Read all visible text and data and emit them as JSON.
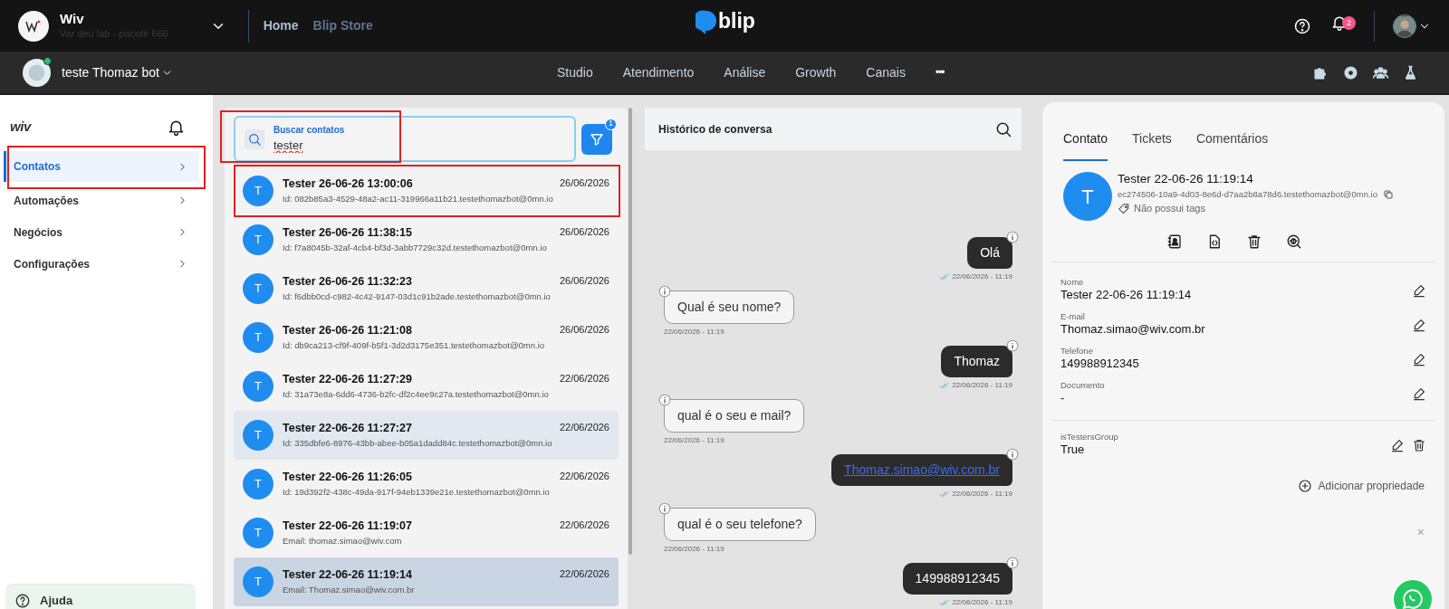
{
  "topbar": {
    "org_name": "Wiv",
    "org_subtitle": "Var deu lab - pacote 666",
    "tabs": [
      {
        "label": "Home",
        "selected": true
      },
      {
        "label": "Blip Store",
        "selected": false
      }
    ],
    "logo": "blip",
    "notification_count": "2"
  },
  "botbar": {
    "bot_name": "teste Thomaz bot",
    "online": true,
    "nav": [
      "Studio",
      "Atendimento",
      "Análise",
      "Growth",
      "Canais"
    ],
    "more": "•••"
  },
  "sidebar": {
    "logo": "wiv",
    "items": [
      {
        "label": "Contatos",
        "selected": true
      },
      {
        "label": "Automações",
        "selected": false
      },
      {
        "label": "Negócios",
        "selected": false
      },
      {
        "label": "Configurações",
        "selected": false
      }
    ],
    "help": "Ajuda"
  },
  "contacts": {
    "search": {
      "label": "Buscar contatos",
      "value": "tester"
    },
    "filter_count": "1",
    "rows": [
      {
        "initial": "T",
        "name": "Tester 26-06-26 13:00:06",
        "detail": "Id: 082b85a3-4529-48a2-ac11-319966a11b21.testethomazbot@0mn.io",
        "date": "26/06/2026",
        "selected": false,
        "hovered": false,
        "highlighted": true
      },
      {
        "initial": "T",
        "name": "Tester 26-06-26 11:38:15",
        "detail": "Id: f7a8045b-32af-4cb4-bf3d-3abb7729c32d.testethomazbot@0mn.io",
        "date": "26/06/2026",
        "selected": false,
        "hovered": false,
        "highlighted": false
      },
      {
        "initial": "T",
        "name": "Tester 26-06-26 11:32:23",
        "detail": "Id: f6dbb0cd-c982-4c42-9147-03d1c91b2ade.testethomazbot@0mn.io",
        "date": "26/06/2026",
        "selected": false,
        "hovered": false,
        "highlighted": false
      },
      {
        "initial": "T",
        "name": "Tester 26-06-26 11:21:08",
        "detail": "Id: db9ca213-cf9f-409f-b5f1-3d2d3175e351.testethomazbot@0mn.io",
        "date": "26/06/2026",
        "selected": false,
        "hovered": false,
        "highlighted": false
      },
      {
        "initial": "T",
        "name": "Tester 22-06-26 11:27:29",
        "detail": "Id: 31a73e8a-6dd6-4736-b2fc-df2c4ee9c27a.testethomazbot@0mn.io",
        "date": "22/06/2026",
        "selected": false,
        "hovered": false,
        "highlighted": false
      },
      {
        "initial": "T",
        "name": "Tester 22-06-26 11:27:27",
        "detail": "Id: 335dbfe6-8976-43bb-abee-b05a1dadd84c.testethomazbot@0mn.io",
        "date": "22/06/2026",
        "selected": false,
        "hovered": true,
        "highlighted": false
      },
      {
        "initial": "T",
        "name": "Tester 22-06-26 11:26:05",
        "detail": "Id: 19d392f2-438c-49da-917f-94eb1339e21e.testethomazbot@0mn.io",
        "date": "22/06/2026",
        "selected": false,
        "hovered": false,
        "highlighted": false
      },
      {
        "initial": "T",
        "name": "Tester 22-06-26 11:19:07",
        "detail": "Email: thomaz.simao@wiv.com",
        "date": "22/06/2026",
        "selected": false,
        "hovered": false,
        "highlighted": false
      },
      {
        "initial": "T",
        "name": "Tester 22-06-26 11:19:14",
        "detail": "Email: Thomaz.simao@wiv.com.br",
        "date": "22/06/2026",
        "selected": true,
        "hovered": false,
        "highlighted": false
      }
    ]
  },
  "chat": {
    "title": "Histórico de conversa",
    "messages": [
      {
        "kind": "outgoing",
        "text": "Olá",
        "time": "22/06/2026 - 11:19",
        "link": false
      },
      {
        "kind": "incoming",
        "text": "Qual é seu nome?",
        "time": "22/06/2026 - 11:19",
        "link": false
      },
      {
        "kind": "outgoing",
        "text": "Thomaz",
        "time": "22/06/2026 - 11:19",
        "link": false
      },
      {
        "kind": "incoming",
        "text": "qual é o seu e mail?",
        "time": "22/06/2026 - 11:19",
        "link": false
      },
      {
        "kind": "outgoing",
        "text": "Thomaz.simao@wiv.com.br",
        "time": "22/06/2026 - 11:19",
        "link": true
      },
      {
        "kind": "incoming",
        "text": "qual é o seu telefone?",
        "time": "22/06/2026 - 11:19",
        "link": false
      },
      {
        "kind": "outgoing",
        "text": "149988912345",
        "time": "22/06/2026 - 11:19",
        "link": false
      }
    ]
  },
  "details": {
    "tabs": [
      {
        "label": "Contato",
        "selected": true
      },
      {
        "label": "Tickets",
        "selected": false
      },
      {
        "label": "Comentários",
        "selected": false
      }
    ],
    "initial": "T",
    "name": "Tester 22-06-26 11:19:14",
    "identity": "ec274506-10a9-4d03-8e6d-d7aa2b8a78d6.testethomazbot@0mn.io",
    "tags": "Não possui tags",
    "fields": [
      {
        "label": "Nome",
        "value": "Tester 22-06-26 11:19:14"
      },
      {
        "label": "E-mail",
        "value": "Thomaz.simao@wiv.com.br"
      },
      {
        "label": "Telefone",
        "value": "149988912345"
      },
      {
        "label": "Documento",
        "value": "-"
      }
    ],
    "custom_fields": [
      {
        "label": "isTestersGroup",
        "value": "True",
        "deletable": true
      }
    ],
    "add_property": "Adicionar propriedade",
    "close": "×"
  }
}
